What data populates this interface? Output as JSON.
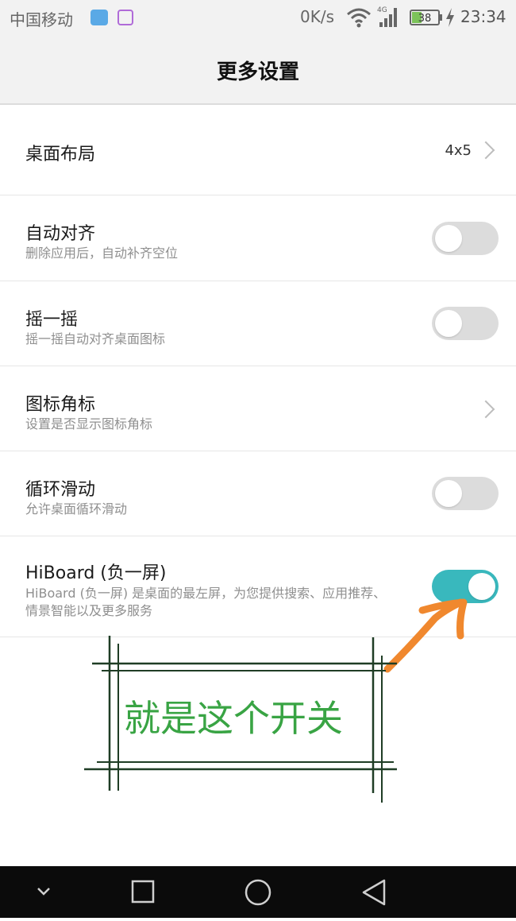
{
  "status_bar": {
    "carrier": "中国移动",
    "net_speed": "0K/s",
    "network_type": "4G",
    "battery": "38",
    "time": "23:34"
  },
  "header": {
    "title": "更多设置"
  },
  "settings": {
    "layout": {
      "label": "桌面布局",
      "value": "4x5"
    },
    "auto_align": {
      "label": "自动对齐",
      "description": "删除应用后，自动补齐空位",
      "enabled": false
    },
    "shake": {
      "label": "摇一摇",
      "description": "摇一摇自动对齐桌面图标",
      "enabled": false
    },
    "icon_badge": {
      "label": "图标角标",
      "description": "设置是否显示图标角标"
    },
    "loop_scroll": {
      "label": "循环滑动",
      "description": "允许桌面循环滑动",
      "enabled": false
    },
    "hiboard": {
      "label": "HiBoard (负一屏)",
      "description_line1": "HiBoard (负一屏) 是桌面的最左屏，为您提供搜索、应用推荐、",
      "description_line2": "情景智能以及更多服务",
      "enabled": true
    }
  },
  "annotation": {
    "text": "就是这个开关"
  },
  "colors": {
    "toggle_on": "#39b8bd",
    "toggle_off": "#dcdcdc",
    "arrow": "#f0882e",
    "frame": "#1f3d25",
    "note_text": "#39a444"
  },
  "nav_bar": {
    "icons": [
      "chevron-down-icon",
      "square-icon",
      "circle-icon",
      "triangle-back-icon"
    ]
  }
}
